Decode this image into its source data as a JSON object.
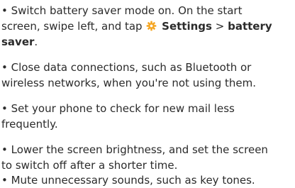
{
  "tips": [
    {
      "lines": [
        "• Switch battery saver mode on. On the start",
        "screen, swipe left, and tap",
        "saver."
      ],
      "settings_label": "Settings",
      "separator": ">",
      "battery_label": "battery",
      "saver_word": "saver",
      "period": ".",
      "icon": "gear-icon",
      "icon_color": "#f5a623"
    },
    {
      "lines": [
        "• Close data connections, such as Bluetooth or",
        "wireless networks, when you're not using them."
      ]
    },
    {
      "lines": [
        "• Set your phone to check for new mail less",
        "frequently."
      ]
    },
    {
      "lines": [
        "• Lower the screen brightness, and set the screen",
        "to switch off after a shorter time."
      ]
    },
    {
      "lines": [
        "• Mute unnecessary sounds, such as key tones."
      ]
    }
  ]
}
